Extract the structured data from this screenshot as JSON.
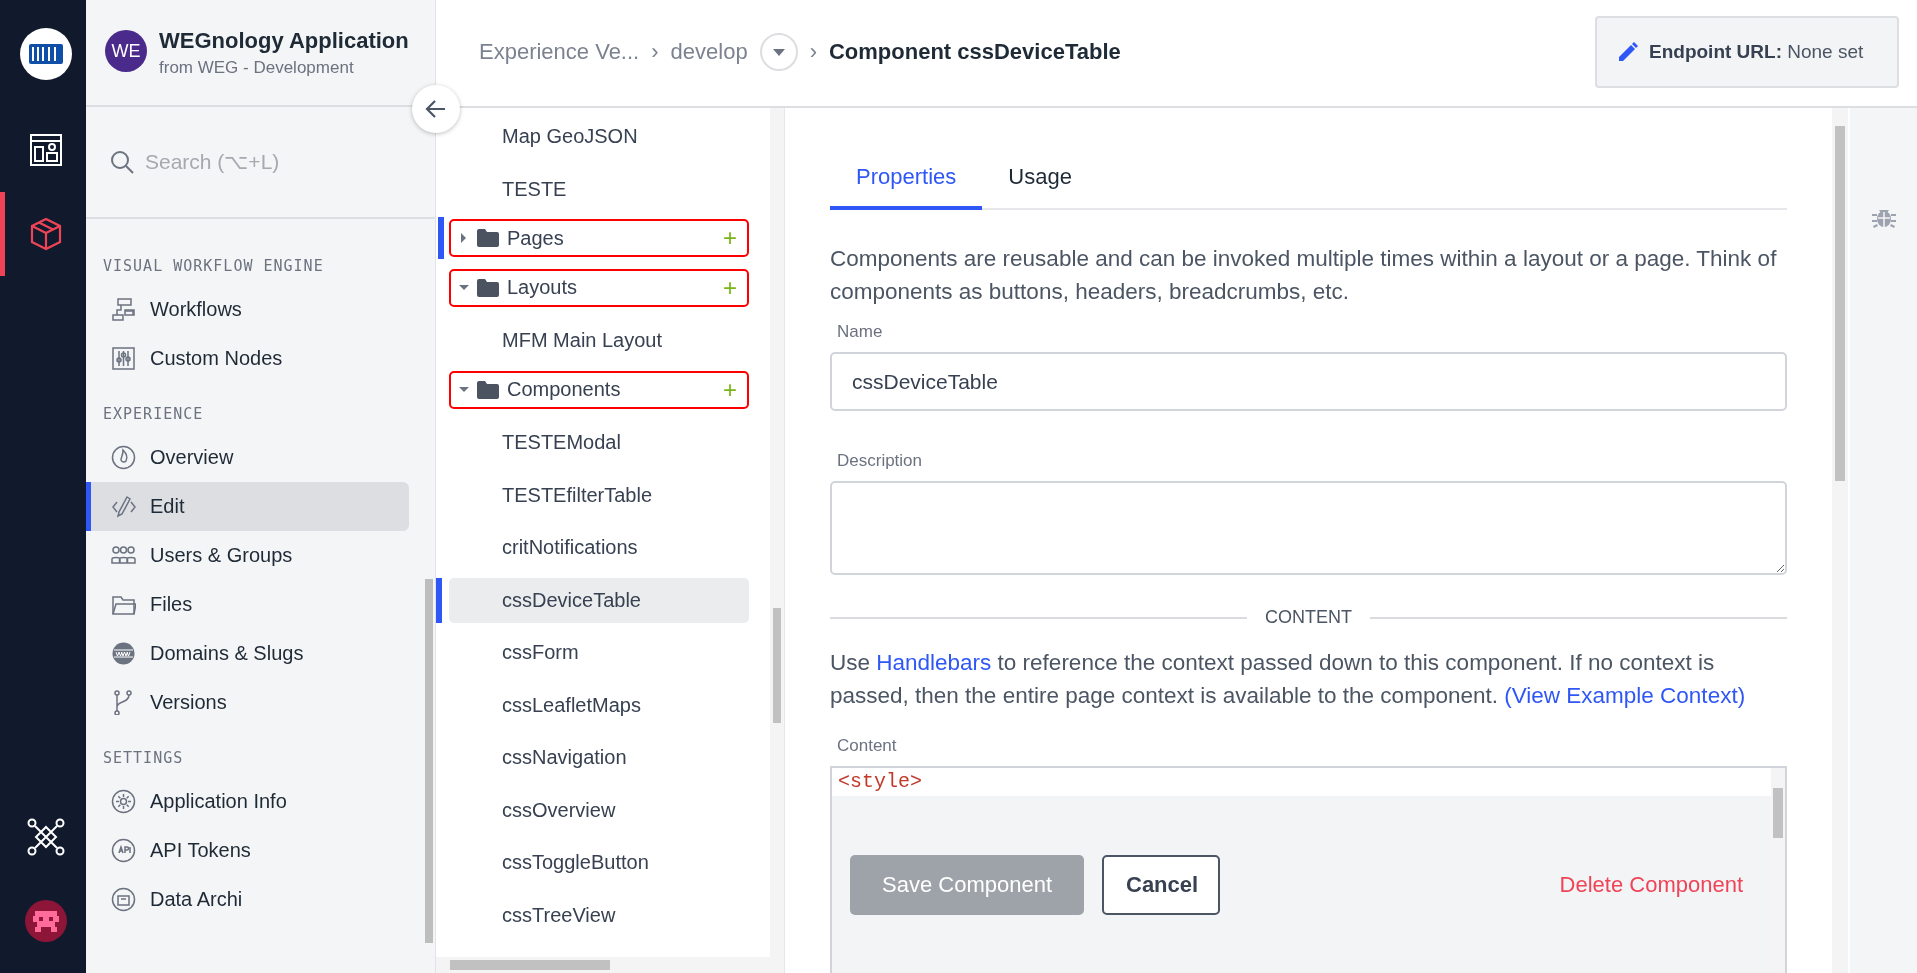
{
  "rail": {
    "items": [
      {
        "kind": "logo",
        "selected": false
      },
      {
        "kind": "dashboard",
        "selected": false
      },
      {
        "kind": "cube",
        "selected": true
      },
      {
        "kind": "network",
        "selected": false
      },
      {
        "kind": "avatar",
        "selected": false
      }
    ]
  },
  "app": {
    "initials": "WE",
    "name": "WEGnology Application",
    "subtitle": "from WEG - Development"
  },
  "search": {
    "placeholder": "Search (⌥+L)"
  },
  "sidebar": {
    "sections": [
      {
        "heading": "VISUAL WORKFLOW ENGINE",
        "items": [
          {
            "label": "Workflows",
            "selected": false
          },
          {
            "label": "Custom Nodes",
            "selected": false
          }
        ]
      },
      {
        "heading": "EXPERIENCE",
        "items": [
          {
            "label": "Overview",
            "selected": false
          },
          {
            "label": "Edit",
            "selected": true
          },
          {
            "label": "Users & Groups",
            "selected": false
          },
          {
            "label": "Files",
            "selected": false
          },
          {
            "label": "Domains & Slugs",
            "selected": false
          },
          {
            "label": "Versions",
            "selected": false
          }
        ]
      },
      {
        "heading": "SETTINGS",
        "items": [
          {
            "label": "Application Info",
            "selected": false
          },
          {
            "label": "API Tokens",
            "selected": false
          },
          {
            "label": "Data Archi",
            "selected": false
          }
        ]
      }
    ]
  },
  "breadcrumb": [
    {
      "kind": "link",
      "label": "Experience Ve..."
    },
    {
      "kind": "separator",
      "label": "›"
    },
    {
      "kind": "dropdown",
      "label": "develop"
    },
    {
      "kind": "separator",
      "label": "›"
    },
    {
      "kind": "current",
      "label": "Component cssDeviceTable"
    }
  ],
  "endpoint": {
    "text": "**Endpoint URL:** None set"
  },
  "tree": [
    {
      "kind": "leaf",
      "label": "Map GeoJSON",
      "selected": false
    },
    {
      "kind": "leaf",
      "label": "TESTE",
      "selected": false
    },
    {
      "kind": "folder",
      "label": "Pages",
      "add": "+",
      "expanded": false,
      "marked": true,
      "outlined": true
    },
    {
      "kind": "folder",
      "label": "Layouts",
      "add": "+",
      "expanded": true,
      "marked": false,
      "outlined": true,
      "children": [
        {
          "kind": "leaf",
          "label": "MFM Main Layout",
          "selected": false
        }
      ]
    },
    {
      "kind": "folder",
      "label": "Components",
      "add": "+",
      "expanded": true,
      "marked": false,
      "outlined": true,
      "children": [
        {
          "kind": "leaf",
          "label": "TESTEModal",
          "selected": false
        },
        {
          "kind": "leaf",
          "label": "TESTEfilterTable",
          "selected": false
        },
        {
          "kind": "leaf",
          "label": "critNotifications",
          "selected": false
        },
        {
          "kind": "leaf",
          "label": "cssDeviceTable",
          "selected": true
        },
        {
          "kind": "leaf",
          "label": "cssForm",
          "selected": false
        },
        {
          "kind": "leaf",
          "label": "cssLeafletMaps",
          "selected": false
        },
        {
          "kind": "leaf",
          "label": "cssNavigation",
          "selected": false
        },
        {
          "kind": "leaf",
          "label": "cssOverview",
          "selected": false
        },
        {
          "kind": "leaf",
          "label": "cssToggleButton",
          "selected": false
        },
        {
          "kind": "leaf",
          "label": "cssTreeView",
          "selected": false
        }
      ]
    }
  ],
  "tabs": [
    {
      "label": "Properties",
      "selected": true
    },
    {
      "label": "Usage",
      "selected": false
    }
  ],
  "intro": "Components are reusable and can be invoked multiple times within a layout or a page. Think of components as buttons, headers, breadcrumbs, etc.",
  "fields": [
    {
      "kind": "input",
      "label": "Name",
      "value": "cssDeviceTable"
    },
    {
      "kind": "textarea",
      "label": "Description"
    }
  ],
  "divider": "CONTENT",
  "help": [
    {
      "kind": "text",
      "text": "Use "
    },
    {
      "kind": "link",
      "text": "Handlebars"
    },
    {
      "kind": "text",
      "text": " to reference the context passed down to this component. If no context is passed, then the entire page context is available to the component. "
    },
    {
      "kind": "link",
      "text": "(View Example Context)"
    }
  ],
  "content": {
    "label": "Content",
    "lines": [
      "<style>"
    ]
  },
  "buttons": [
    {
      "kind": "primary",
      "label": "Save Component",
      "disabled": true
    },
    {
      "kind": "secondary",
      "label": "Cancel",
      "disabled": false
    },
    {
      "kind": "danger",
      "label": "Delete Component",
      "disabled": false
    }
  ]
}
